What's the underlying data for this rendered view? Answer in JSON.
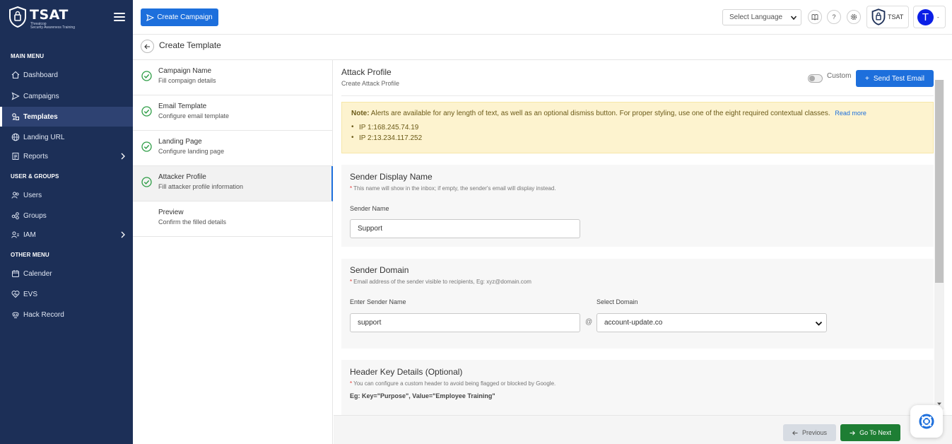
{
  "brand": {
    "title": "TSAT",
    "subtitle1": "Threatcop",
    "subtitle2": "Security Awareness Training"
  },
  "sidebar": {
    "main_menu_label": "MAIN MENU",
    "user_groups_label": "USER & GROUPS",
    "other_menu_label": "OTHER MENU",
    "items": [
      {
        "label": "Dashboard",
        "icon": "home-icon"
      },
      {
        "label": "Campaigns",
        "icon": "send-icon"
      },
      {
        "label": "Templates",
        "icon": "templates-icon",
        "active": true
      },
      {
        "label": "Landing URL",
        "icon": "globe-icon"
      },
      {
        "label": "Reports",
        "icon": "report-icon"
      },
      {
        "label": "Users",
        "icon": "users-icon"
      },
      {
        "label": "Groups",
        "icon": "groups-icon"
      },
      {
        "label": "IAM",
        "icon": "iam-icon"
      },
      {
        "label": "Calender",
        "icon": "calendar-icon"
      },
      {
        "label": "EVS",
        "icon": "heart-icon"
      },
      {
        "label": "Hack Record",
        "icon": "hack-icon"
      }
    ]
  },
  "topbar": {
    "create_campaign_label": "Create Campaign",
    "language_placeholder": "Select Language",
    "help_label": "?",
    "tsat_label": "TSAT",
    "avatar_initial": "T"
  },
  "page": {
    "title": "Create Template"
  },
  "steps": [
    {
      "title": "Campaign Name",
      "subtitle": "Fill compaign details",
      "done": true
    },
    {
      "title": "Email Template",
      "subtitle": "Configure email template",
      "done": true
    },
    {
      "title": "Landing Page",
      "subtitle": "Configure landing page",
      "done": true
    },
    {
      "title": "Attacker Profile",
      "subtitle": "Fill attacker profile information",
      "done": true,
      "active": true
    },
    {
      "title": "Preview",
      "subtitle": "Confirm the filled details",
      "done": false
    }
  ],
  "attack_profile": {
    "title": "Attack Profile",
    "subtitle": "Create Attack Profile",
    "custom_label": "Custom",
    "send_test_label": "Send Test Email"
  },
  "alert": {
    "note_label": "Note:",
    "text": "Alerts are available for any length of text, as well as an optional dismiss button. For proper styling, use one of the eight required contextual classes.",
    "read_more": "Read more",
    "ips": [
      "IP 1:168.245.74.19",
      "IP 2:13.234.117.252"
    ]
  },
  "sender_display": {
    "title": "Sender Display Name",
    "note": "This name will show in the inbox; if empty, the sender's email will display instead.",
    "field_label": "Sender Name",
    "value": "Support"
  },
  "sender_domain": {
    "title": "Sender Domain",
    "note": "Email address of the sender visible to recipients, Eg: xyz@domain.com",
    "name_label": "Enter Sender Name",
    "name_value": "support",
    "at": "@",
    "domain_label": "Select Domain",
    "domain_value": "account-update.co"
  },
  "header_key": {
    "title": "Header Key Details (Optional)",
    "note": "You can configure a custom header to avoid being flagged or blocked by Google.",
    "example": "Eg: Key=\"Purpose\", Value=\"Employee Training\""
  },
  "footer": {
    "previous_label": "Previous",
    "next_label": "Go To Next"
  },
  "colors": {
    "sidebar_bg": "#1c2f57",
    "primary": "#1d6fdc",
    "success": "#1e7e34",
    "alert_bg": "#fdf3cf"
  }
}
